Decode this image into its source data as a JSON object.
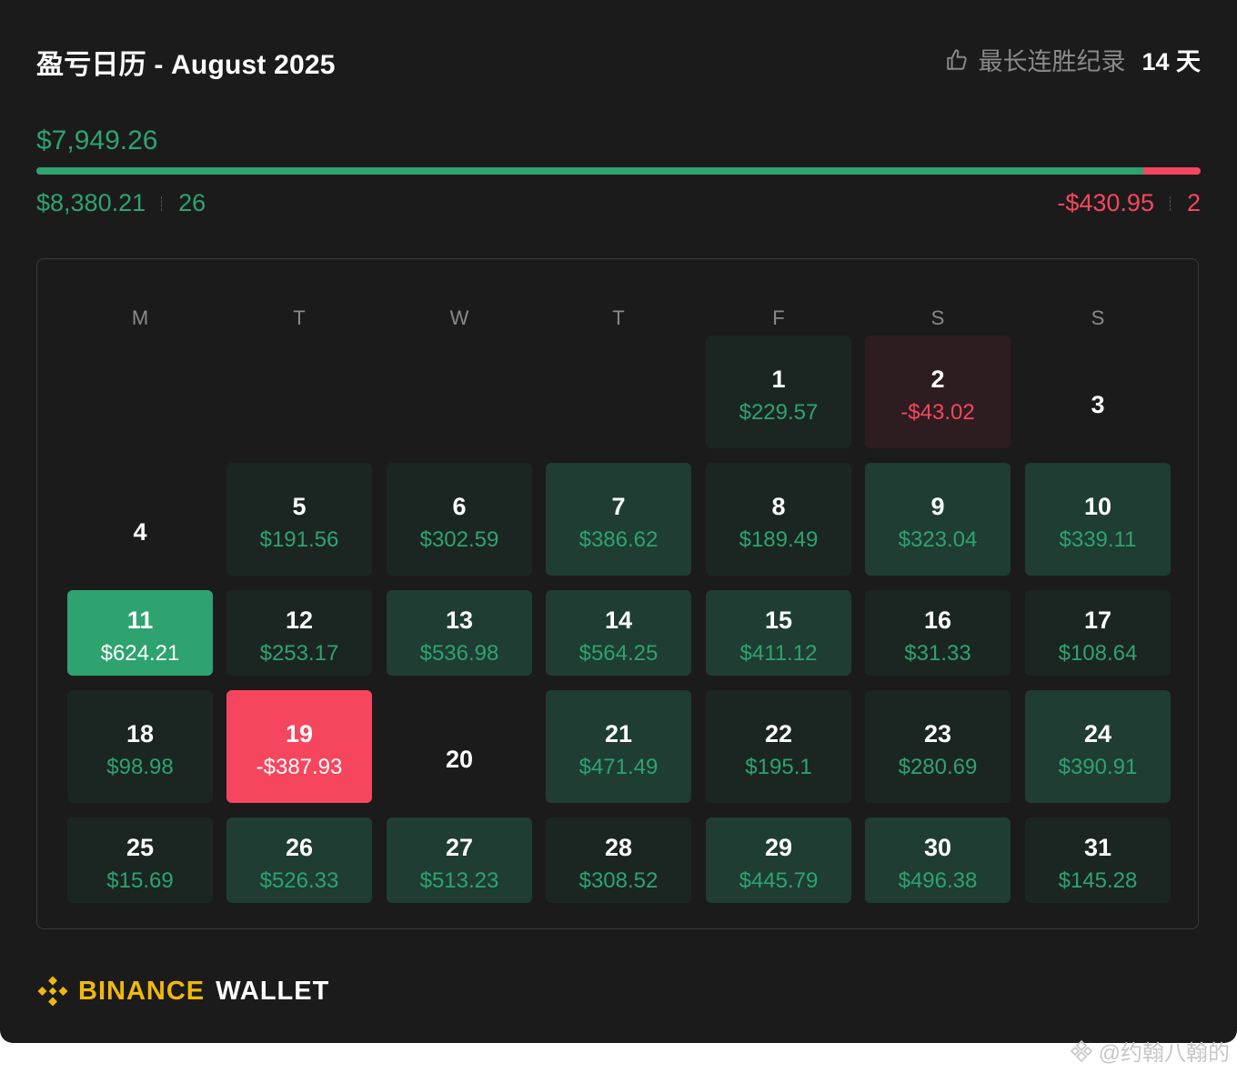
{
  "header": {
    "title": "盈亏日历 - August 2025",
    "streak_label": "最长连胜纪录",
    "streak_value": "14 天",
    "streak_icon": "thumbs-up-icon"
  },
  "summary": {
    "net_pnl": "$7,949.26",
    "profit_total": "$8,380.21",
    "profit_days": "26",
    "loss_total": "-$430.95",
    "loss_days": "2",
    "profit_share": 0.951
  },
  "calendar": {
    "weekdays": [
      "M",
      "T",
      "W",
      "T",
      "F",
      "S",
      "S"
    ],
    "days": [
      {
        "day": "1",
        "amount": "$229.57",
        "tone": "d"
      },
      {
        "day": "2",
        "amount": "-$43.02",
        "tone": "l"
      },
      {
        "day": "3",
        "amount": "",
        "tone": "n"
      },
      {
        "day": "4",
        "amount": "",
        "tone": "n"
      },
      {
        "day": "5",
        "amount": "$191.56",
        "tone": "d"
      },
      {
        "day": "6",
        "amount": "$302.59",
        "tone": "d"
      },
      {
        "day": "7",
        "amount": "$386.62",
        "tone": "m"
      },
      {
        "day": "8",
        "amount": "$189.49",
        "tone": "d"
      },
      {
        "day": "9",
        "amount": "$323.04",
        "tone": "m"
      },
      {
        "day": "10",
        "amount": "$339.11",
        "tone": "m"
      },
      {
        "day": "11",
        "amount": "$624.21",
        "tone": "b"
      },
      {
        "day": "12",
        "amount": "$253.17",
        "tone": "d"
      },
      {
        "day": "13",
        "amount": "$536.98",
        "tone": "m"
      },
      {
        "day": "14",
        "amount": "$564.25",
        "tone": "m"
      },
      {
        "day": "15",
        "amount": "$411.12",
        "tone": "m"
      },
      {
        "day": "16",
        "amount": "$31.33",
        "tone": "d"
      },
      {
        "day": "17",
        "amount": "$108.64",
        "tone": "d"
      },
      {
        "day": "18",
        "amount": "$98.98",
        "tone": "d"
      },
      {
        "day": "19",
        "amount": "-$387.93",
        "tone": "r"
      },
      {
        "day": "20",
        "amount": "",
        "tone": "n"
      },
      {
        "day": "21",
        "amount": "$471.49",
        "tone": "m"
      },
      {
        "day": "22",
        "amount": "$195.1",
        "tone": "d"
      },
      {
        "day": "23",
        "amount": "$280.69",
        "tone": "d"
      },
      {
        "day": "24",
        "amount": "$390.91",
        "tone": "m"
      },
      {
        "day": "25",
        "amount": "$15.69",
        "tone": "d"
      },
      {
        "day": "26",
        "amount": "$526.33",
        "tone": "m"
      },
      {
        "day": "27",
        "amount": "$513.23",
        "tone": "m"
      },
      {
        "day": "28",
        "amount": "$308.52",
        "tone": "d"
      },
      {
        "day": "29",
        "amount": "$445.79",
        "tone": "m"
      },
      {
        "day": "30",
        "amount": "$496.38",
        "tone": "m"
      },
      {
        "day": "31",
        "amount": "$145.28",
        "tone": "d"
      }
    ]
  },
  "footer": {
    "brand_primary": "BINANCE",
    "brand_secondary": "WALLET",
    "logo_icon": "binance-diamond-logo"
  },
  "watermark": {
    "text": "@约翰八翰的",
    "icon": "binance-square-icon"
  },
  "colors": {
    "profit": "#2ea36f",
    "loss": "#f6465d",
    "brand": "#f0b90b",
    "background": "#1b1b1c"
  }
}
